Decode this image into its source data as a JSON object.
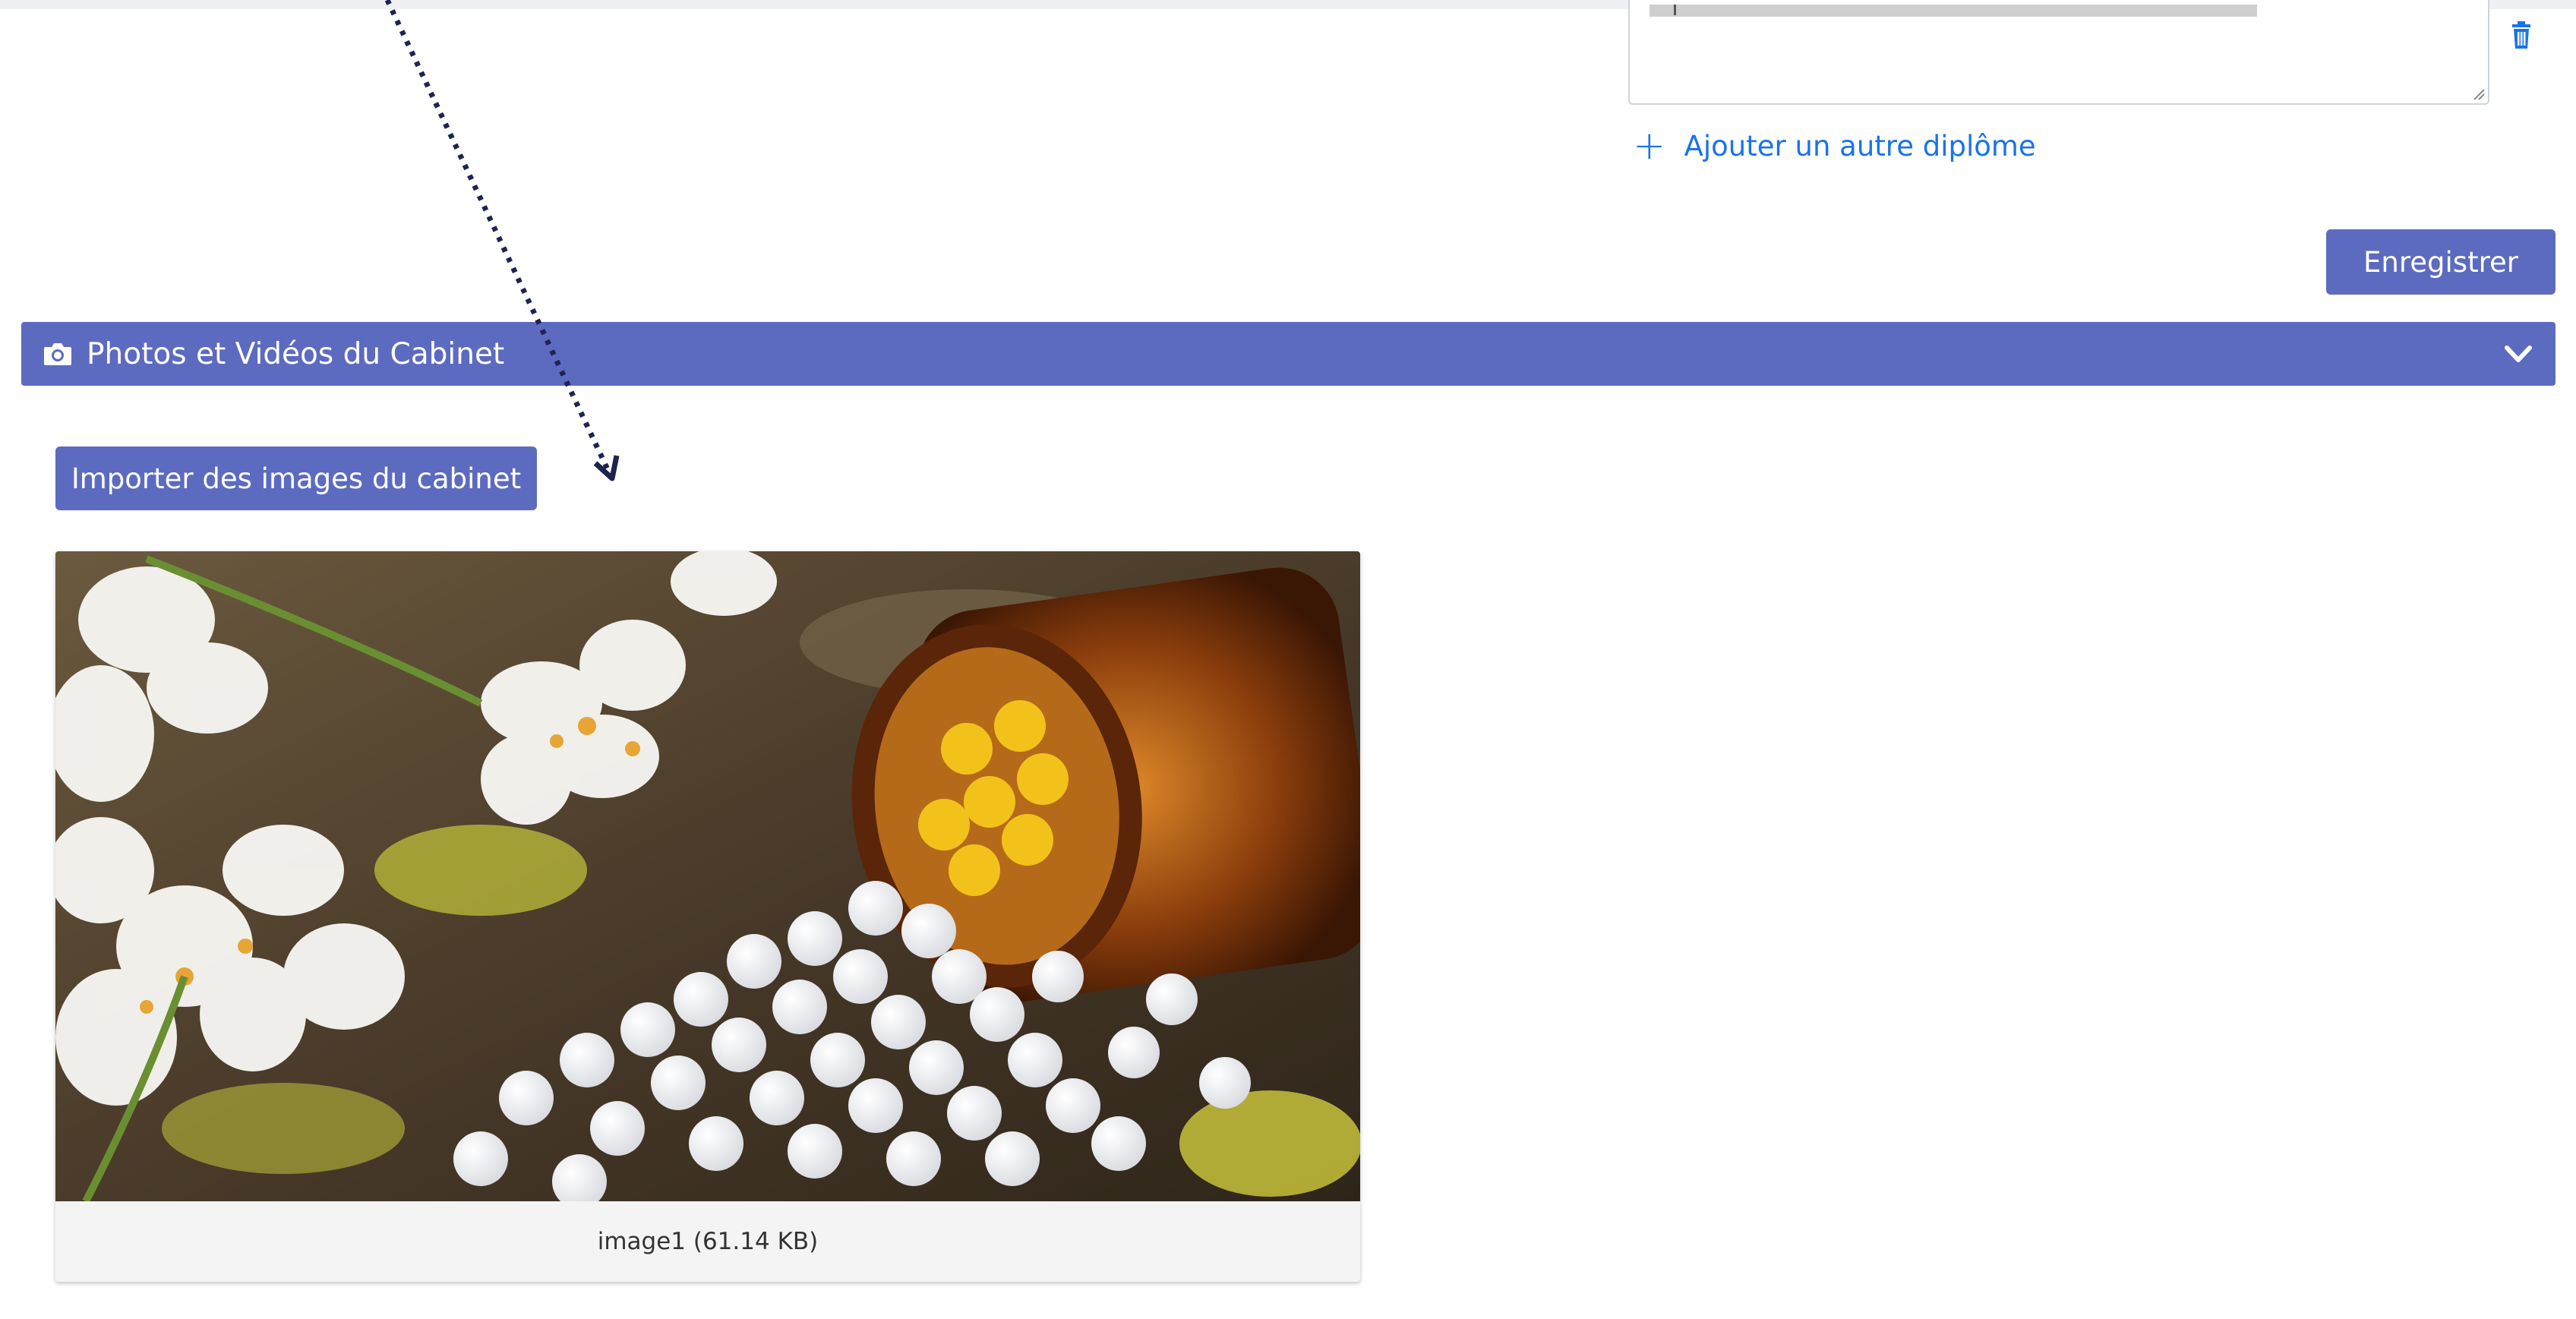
{
  "diplomas": {
    "add_link_label": "Ajouter un autre diplôme",
    "add_icon": "+",
    "save_label": "Enregistrer"
  },
  "cabinet_media": {
    "section_title": "Photos et Vidéos du Cabinet",
    "import_button_label": "Importer des images du cabinet",
    "images": [
      {
        "caption": "image1 (61.14 KB)"
      }
    ]
  },
  "colors": {
    "primary": "#5c6bc0",
    "link": "#1a73e8"
  }
}
